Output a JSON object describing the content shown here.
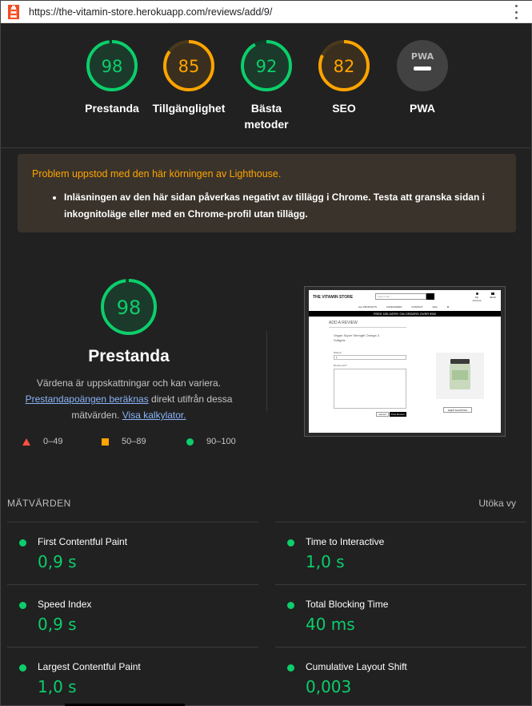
{
  "browser": {
    "url": "https://the-vitamin-store.herokuapp.com/reviews/add/9/"
  },
  "colors": {
    "pass": "#0cce6b",
    "average": "#ffa400",
    "fail": "#ff4e42",
    "pwa": "#4d4d4d"
  },
  "gauges": [
    {
      "score": "98",
      "label": "Prestanda",
      "status": "pass"
    },
    {
      "score": "85",
      "label": "Tillgänglighet",
      "status": "average"
    },
    {
      "score": "92",
      "label": "Bästa metoder",
      "status": "pass"
    },
    {
      "score": "82",
      "label": "SEO",
      "status": "average"
    },
    {
      "score": "",
      "label": "PWA",
      "status": "pwa",
      "badge": "PWA"
    }
  ],
  "warning": {
    "title": "Problem uppstod med den här körningen av Lighthouse.",
    "items": [
      "Inläsningen av den här sidan påverkas negativt av tillägg i Chrome. Testa att granska sidan i inkognitoläge eller med en Chrome-profil utan tillägg."
    ]
  },
  "performance": {
    "score": "98",
    "title": "Prestanda",
    "desc_1": "Värdena är uppskattningar och kan variera.",
    "link_1": "Prestandapoängen beräknas",
    "desc_2": " direkt utifrån dessa mätvärden.",
    "link_2": "Visa kalkylator.",
    "legend": {
      "fail": "0–49",
      "average": "50–89",
      "pass": "90–100"
    }
  },
  "screenshot": {
    "store_name": "THE VITAMIN STORE",
    "search_placeholder": "Search site...",
    "account_label": "My Account",
    "bag_label": "$0.00",
    "nav": [
      "ALL PRODUCTS",
      "CATEGORIES",
      "CONTACT",
      "FAQ",
      "⚙"
    ],
    "banner": "FREE DELIVERY ON ORDERS OVER €50!",
    "heading": "ADD A REVIEW",
    "product": "Vegan Super Strength Omega 3 Softgels",
    "rating_label": "Rating*",
    "rating_value": "1",
    "review_label": "Review text*",
    "cancel": "Cancel",
    "post": "Post Review",
    "keep_shopping": "KEEP SHOPPING"
  },
  "metrics": {
    "heading": "MÄTVÄRDEN",
    "expand": "Utöka vy",
    "items": [
      {
        "name": "First Contentful Paint",
        "value": "0,9 s"
      },
      {
        "name": "Time to Interactive",
        "value": "1,0 s"
      },
      {
        "name": "Speed Index",
        "value": "0,9 s"
      },
      {
        "name": "Total Blocking Time",
        "value": "40 ms"
      },
      {
        "name": "Largest Contentful Paint",
        "value": "1,0 s"
      },
      {
        "name": "Cumulative Layout Shift",
        "value": "0,003"
      }
    ]
  }
}
